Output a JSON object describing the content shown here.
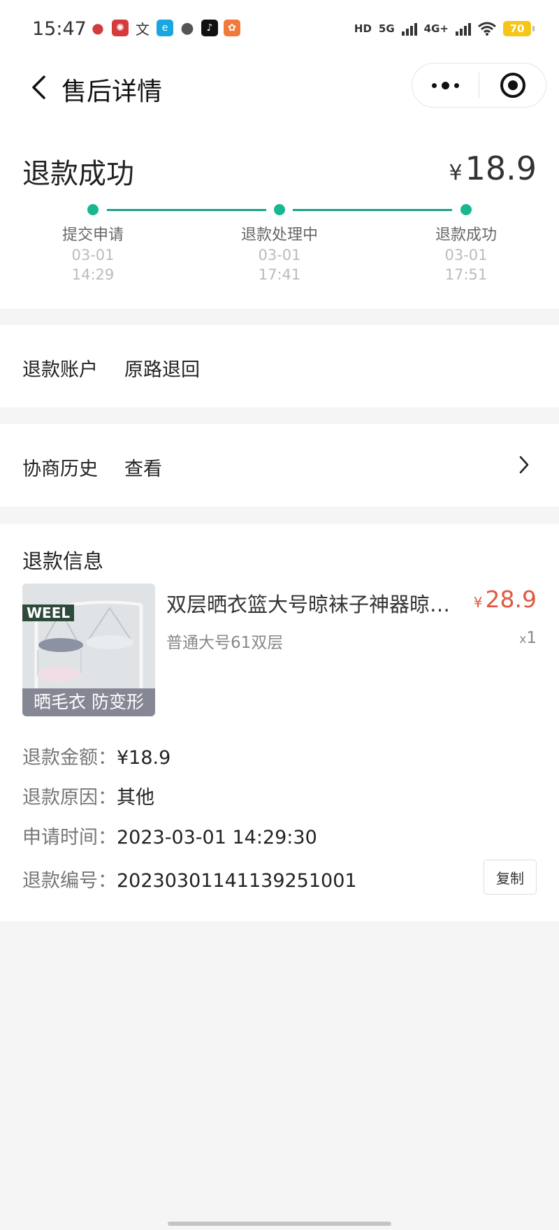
{
  "status_bar": {
    "time": "15:47",
    "app_icons": [
      {
        "icon": "map-pin-icon",
        "color": "#d43c3c"
      },
      {
        "icon": "sparkle-icon",
        "color": "#d43c3c"
      },
      {
        "icon": "translate-icon",
        "color": "#333333"
      },
      {
        "icon": "browser-icon",
        "color": "#1aa6e0"
      },
      {
        "icon": "chat-bubble-icon",
        "color": "#555555"
      },
      {
        "icon": "tiktok-icon",
        "color": "#111111"
      },
      {
        "icon": "app-orange-icon",
        "color": "#f07a3a"
      }
    ],
    "hd": "HD",
    "net1": "5G",
    "net2": "4G+",
    "battery": "70"
  },
  "nav": {
    "title": "售后详情"
  },
  "refund_status": {
    "title": "退款成功",
    "currency": "¥",
    "amount": "18.9",
    "steps": [
      {
        "label": "提交申请",
        "date": "03-01",
        "time": "14:29"
      },
      {
        "label": "退款处理中",
        "date": "03-01",
        "time": "17:41"
      },
      {
        "label": "退款成功",
        "date": "03-01",
        "time": "17:51"
      }
    ]
  },
  "account_row": {
    "label": "退款账户",
    "value": "原路退回"
  },
  "history_row": {
    "label": "协商历史",
    "value": "查看"
  },
  "info": {
    "title": "退款信息",
    "product": {
      "thumb_tag": "WEEL",
      "thumb_caption": "晒毛衣 防变形",
      "name": "双层晒衣篮大号晾袜子神器晾…",
      "currency": "¥",
      "price": "28.9",
      "spec": "普通大号61双层",
      "qty_prefix": "x",
      "qty": "1"
    },
    "fields": [
      {
        "key": "退款金额：",
        "value": "¥18.9"
      },
      {
        "key": "退款原因：",
        "value": "其他"
      },
      {
        "key": "申请时间：",
        "value": "2023-03-01 14:29:30"
      },
      {
        "key": "退款编号：",
        "value": "20230301141139251001"
      }
    ],
    "copy_label": "复制"
  },
  "colors": {
    "accent_green": "#17b890",
    "price_red": "#e2573f"
  }
}
